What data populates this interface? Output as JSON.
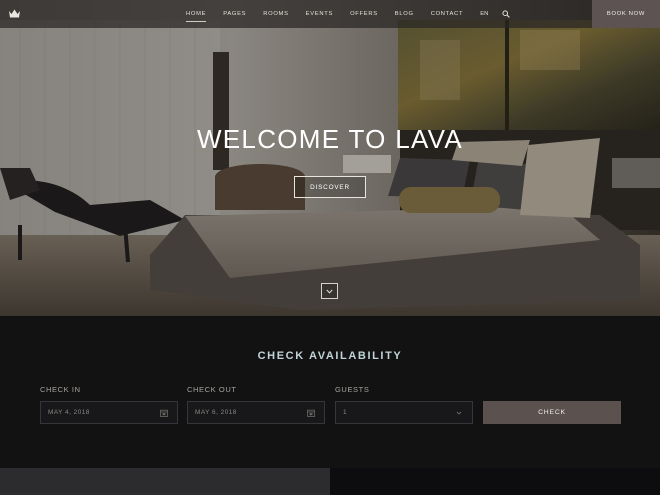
{
  "nav": {
    "items": [
      "HOME",
      "PAGES",
      "ROOMS",
      "EVENTS",
      "OFFERS",
      "BLOG",
      "CONTACT"
    ],
    "active_index": 0,
    "lang": "EN",
    "book_label": "BOOK NOW",
    "logo_icon": "crown-icon",
    "search_icon": "search-icon"
  },
  "hero": {
    "title": "WELCOME TO LAVA",
    "button_label": "DISCOVER",
    "scroll_icon": "chevron-down-icon"
  },
  "availability": {
    "title": "CHECK AVAILABILITY",
    "check_in": {
      "label": "CHECK IN",
      "value": "MAY 4, 2018",
      "icon": "calendar-icon"
    },
    "check_out": {
      "label": "CHECK OUT",
      "value": "MAY 6, 2018",
      "icon": "calendar-icon"
    },
    "guests": {
      "label": "GUESTS",
      "value": "1",
      "icon": "chevron-down-icon"
    },
    "button_label": "CHECK"
  },
  "colors": {
    "accent_title": "#c2d4d8",
    "button_bg": "#5b5250",
    "section_bg": "#121212"
  }
}
